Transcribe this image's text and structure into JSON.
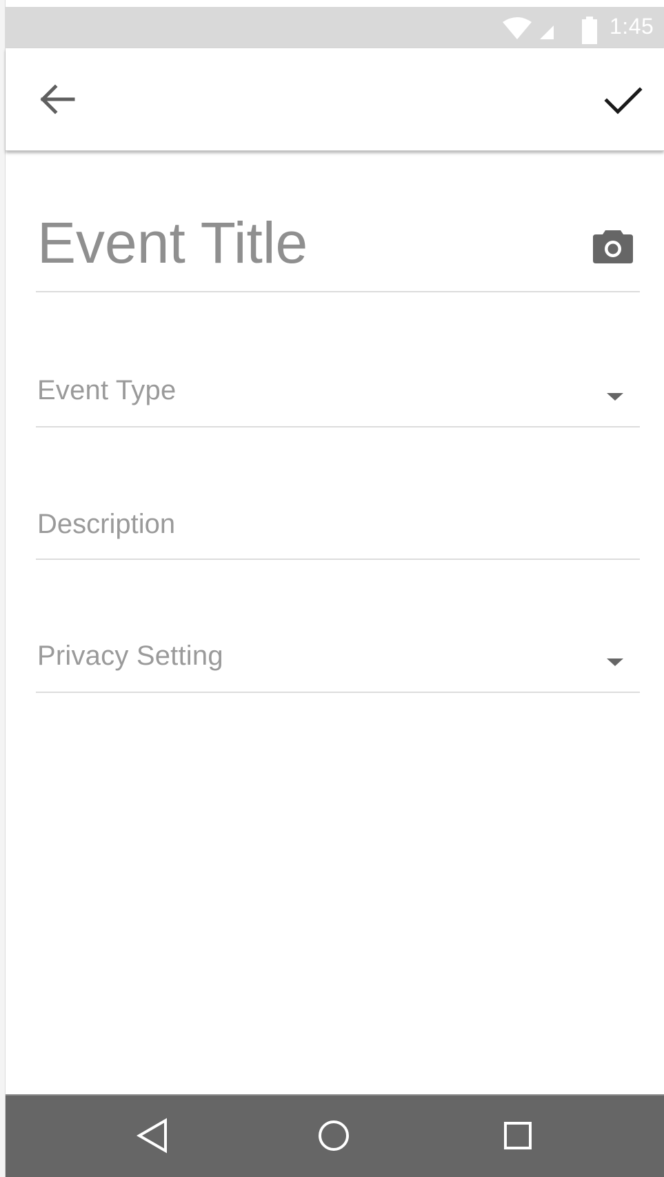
{
  "status_bar": {
    "time": "1:45",
    "icons": [
      "wifi-icon",
      "signal-icon",
      "battery-icon"
    ]
  },
  "app_bar": {
    "back_icon": "arrow-back-icon",
    "confirm_icon": "check-icon"
  },
  "form": {
    "title_placeholder": "Event Title",
    "camera_icon": "camera-icon",
    "event_type_label": "Event Type",
    "description_placeholder": "Description",
    "privacy_label": "Privacy Setting",
    "dropdown_icon": "dropdown-arrow-icon"
  },
  "nav_bar": {
    "icons": [
      "nav-back-icon",
      "nav-home-icon",
      "nav-recents-icon"
    ]
  },
  "colors": {
    "status_bar_bg": "#d9d9d9",
    "nav_bar_bg": "#666666",
    "hint_text": "#9a9a9a",
    "divider": "#dcdcdc"
  }
}
